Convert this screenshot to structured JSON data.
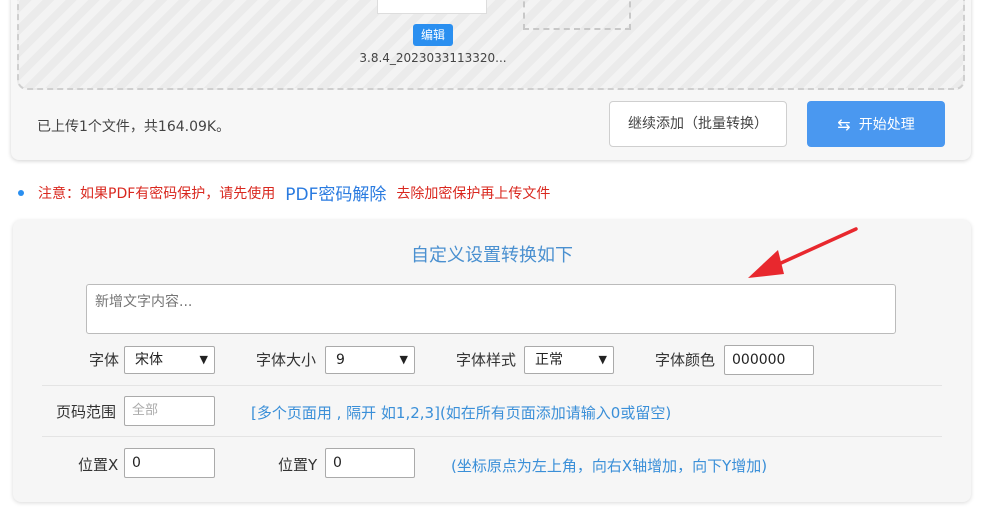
{
  "upload": {
    "edit_label": "编辑",
    "file_name": "3.8.4_2023033113320...",
    "status": "已上传1个文件，共164.09K。",
    "continue_label": "继续添加（批量转换）",
    "start_label": "开始处理",
    "start_icon": "swap-arrows-icon"
  },
  "notice": {
    "before": "注意：如果PDF有密码保护，请先使用",
    "link": "PDF密码解除",
    "after": "去除加密保护再上传文件"
  },
  "settings": {
    "title": "自定义设置转换如下",
    "text_placeholder": "新增文字内容...",
    "font_label": "字体",
    "font_value": "宋体",
    "size_label": "字体大小",
    "size_value": "9",
    "style_label": "字体样式",
    "style_value": "正常",
    "color_label": "字体颜色",
    "color_value": "000000",
    "page_label": "页码范围",
    "page_placeholder": "全部",
    "page_hint": "[多个页面用 , 隔开 如1,2,3](如在所有页面添加请输入0或留空)",
    "posx_label": "位置X",
    "posx_value": "0",
    "posy_label": "位置Y",
    "posy_value": "0",
    "pos_hint": "(坐标原点为左上角，向右X轴增加，向下Y增加)"
  },
  "colors": {
    "accent": "#4a98f0",
    "link": "#2a7be0",
    "warning": "#d9281f",
    "annotation_arrow": "#e8282e"
  }
}
